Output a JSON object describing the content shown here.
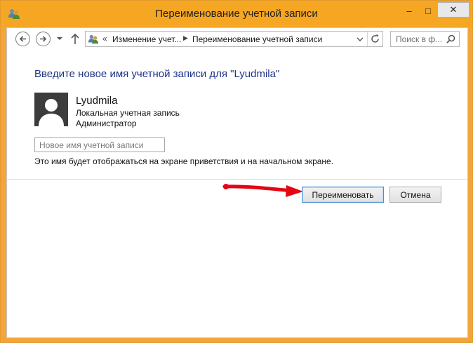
{
  "window": {
    "title": "Переименование учетной записи",
    "controls": {
      "minimize": "–",
      "maximize": "□",
      "close": "✕"
    }
  },
  "navbar": {
    "breadcrumb_prefix": "«",
    "crumbs": [
      "Изменение учет...",
      "Переименование учетной записи"
    ],
    "crumb_separator": "▶",
    "search_placeholder": "Поиск в ф..."
  },
  "content": {
    "heading": "Введите новое имя учетной записи для \"Lyudmila\"",
    "user": {
      "name": "Lyudmila",
      "account_type": "Локальная учетная запись",
      "role": "Администратор"
    },
    "new_name_placeholder": "Новое имя учетной записи",
    "new_name_value": "",
    "hint": "Это имя будет отображаться на экране приветствия и на начальном экране."
  },
  "buttons": {
    "rename": "Переименовать",
    "cancel": "Отмена"
  },
  "colors": {
    "window_frame": "#f5a623",
    "heading": "#1e3287",
    "annotation_arrow": "#e30613",
    "default_button_border": "#4a8fd6"
  },
  "icons": [
    "users-icon",
    "back-arrow-icon",
    "forward-arrow-icon",
    "dropdown-icon",
    "up-arrow-icon",
    "refresh-icon",
    "search-icon",
    "user-silhouette-icon"
  ]
}
